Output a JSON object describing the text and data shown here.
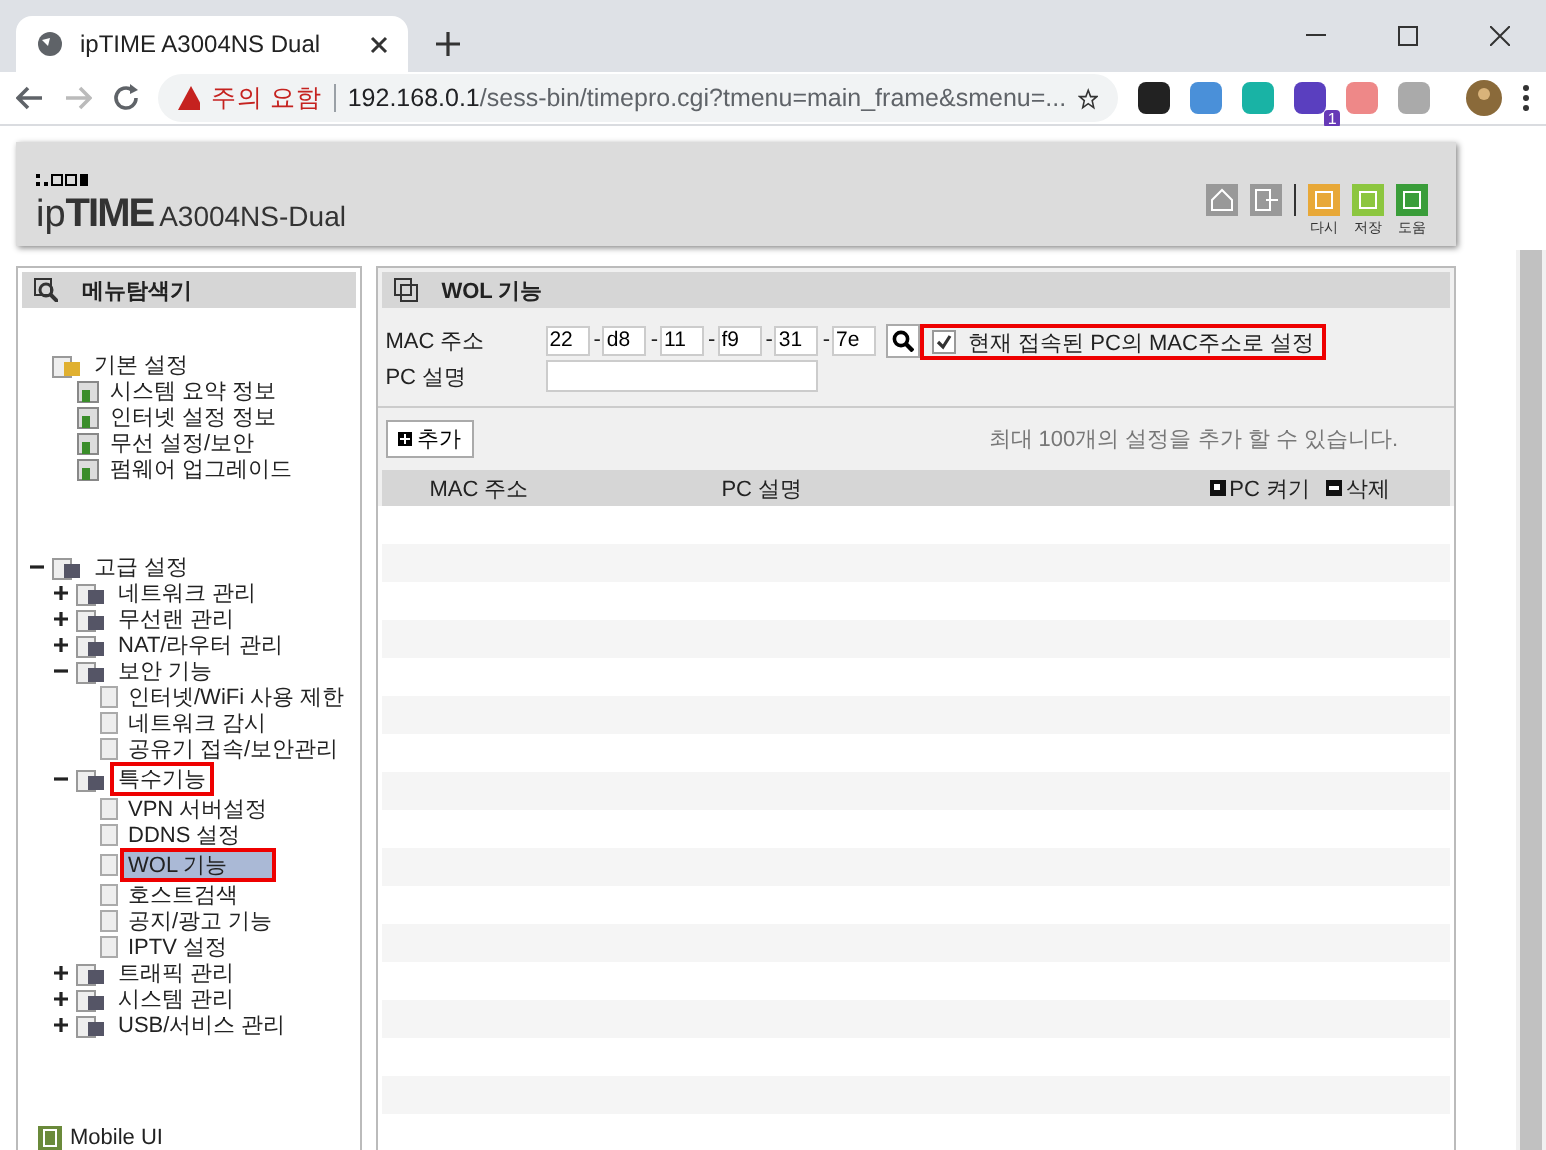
{
  "browser": {
    "tab": {
      "title": "ipTIME A3004NS Dual"
    },
    "security": "주의 요함",
    "url_host": "192.168.0.1",
    "url_path": "/sess-bin/timepro.cgi?tmenu=main_frame&smenu=...",
    "extension_badge": "1"
  },
  "router": {
    "model": "A3004NS-Dual",
    "brand_prefix": "ip",
    "brand_mark": "TIME",
    "actions": [
      {
        "label": "다시",
        "color": "#e8a838"
      },
      {
        "label": "저장",
        "color": "#8cc63f"
      },
      {
        "label": "도움",
        "color": "#3a9d3a"
      }
    ]
  },
  "sidebar": {
    "title": "메뉴탐색기",
    "tree": [
      {
        "label": "기본 설정",
        "kind": "static",
        "marked": false,
        "selected": false,
        "children": [
          {
            "label": "시스템 요약 정보",
            "kind": "page",
            "marked": false,
            "selected": false
          },
          {
            "label": "인터넷 설정 정보",
            "kind": "page",
            "marked": false,
            "selected": false
          },
          {
            "label": "무선 설정/보안",
            "kind": "page",
            "marked": false,
            "selected": false
          },
          {
            "label": "펌웨어 업그레이드",
            "kind": "page",
            "marked": false,
            "selected": false
          }
        ]
      },
      {
        "label": "고급 설정",
        "kind": "folder",
        "expanded": true,
        "marked": false,
        "selected": false,
        "children": [
          {
            "label": "네트워크 관리",
            "kind": "folder",
            "expanded": false,
            "marked": false,
            "selected": false
          },
          {
            "label": "무선랜 관리",
            "kind": "folder",
            "expanded": false,
            "marked": false,
            "selected": false
          },
          {
            "label": "NAT/라우터 관리",
            "kind": "folder",
            "expanded": false,
            "marked": false,
            "selected": false
          },
          {
            "label": "보안 기능",
            "kind": "folder",
            "expanded": true,
            "marked": false,
            "selected": false,
            "children": [
              {
                "label": "인터넷/WiFi 사용 제한",
                "kind": "leaf",
                "marked": false,
                "selected": false
              },
              {
                "label": "네트워크 감시",
                "kind": "leaf",
                "marked": false,
                "selected": false
              },
              {
                "label": "공유기 접속/보안관리",
                "kind": "leaf",
                "marked": false,
                "selected": false
              }
            ]
          },
          {
            "label": "특수기능",
            "kind": "folder",
            "expanded": true,
            "marked": true,
            "selected": false,
            "children": [
              {
                "label": "VPN 서버설정",
                "kind": "leaf",
                "marked": false,
                "selected": false
              },
              {
                "label": "DDNS 설정",
                "kind": "leaf",
                "marked": false,
                "selected": false
              },
              {
                "label": "WOL 기능",
                "kind": "leaf",
                "marked": true,
                "selected": true
              },
              {
                "label": "호스트검색",
                "kind": "leaf",
                "marked": false,
                "selected": false
              },
              {
                "label": "공지/광고 기능",
                "kind": "leaf",
                "marked": false,
                "selected": false
              },
              {
                "label": "IPTV 설정",
                "kind": "leaf",
                "marked": false,
                "selected": false
              }
            ]
          },
          {
            "label": "트래픽 관리",
            "kind": "folder",
            "expanded": false,
            "marked": false,
            "selected": false
          },
          {
            "label": "시스템 관리",
            "kind": "folder",
            "expanded": false,
            "marked": false,
            "selected": false
          },
          {
            "label": "USB/서비스 관리",
            "kind": "folder",
            "expanded": false,
            "marked": false,
            "selected": false
          }
        ]
      }
    ],
    "footer_link": "Mobile UI"
  },
  "panel": {
    "title": "WOL 기능",
    "mac_label": "MAC 주소",
    "mac_octets": [
      "22",
      "d8",
      "11",
      "f9",
      "31",
      "7e"
    ],
    "mac_separator": "-",
    "pc_label": "PC 설명",
    "current_pc": {
      "label": "현재 접속된 PC의 MAC주소로 설정",
      "checked": true,
      "marked": true
    },
    "add_button": "추가",
    "limit_note": "최대 100개의 설정을 추가 할 수 있습니다.",
    "table": {
      "columns": [
        "MAC 주소",
        "PC 설명"
      ],
      "actions": [
        "PC 켜기",
        "삭제"
      ]
    }
  }
}
